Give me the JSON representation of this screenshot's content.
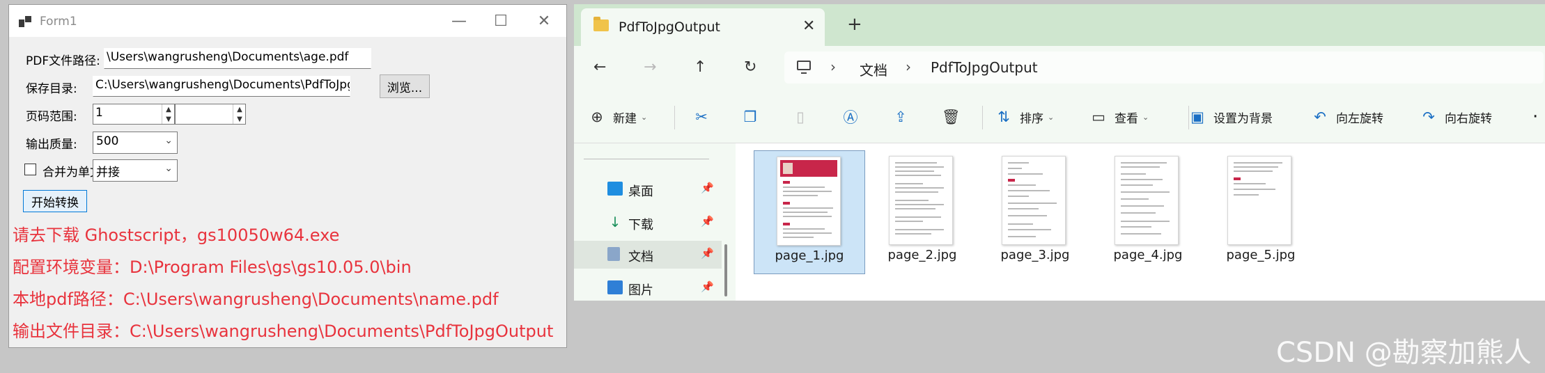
{
  "form1": {
    "title": "Form1",
    "window_controls": {
      "minimize": "—",
      "maximize": "☐",
      "close": "✕"
    },
    "pdf_path_label": "PDF文件路径:",
    "pdf_path_value": "\\Users\\wangrusheng\\Documents\\age.pdf",
    "save_dir_label": "保存目录:",
    "save_dir_value": "C:\\Users\\wangrusheng\\Documents\\PdfToJpgOutput",
    "browse_label": "浏览...",
    "page_range_label": "页码范围:",
    "page_from_value": "1",
    "page_to_value": "",
    "quality_label": "输出质量:",
    "quality_value": "500",
    "merge_label": "合并为单文件",
    "merge_mode_value": "并接",
    "start_label": "开始转换"
  },
  "notes": [
    "请去下载 Ghostscript，gs10050w64.exe",
    "配置环境变量：D:\\Program Files\\gs\\gs10.05.0\\bin",
    "本地pdf路径：C:\\Users\\wangrusheng\\Documents\\name.pdf",
    "输出文件目录：C:\\Users\\wangrusheng\\Documents\\PdfToJpgOutput"
  ],
  "explorer": {
    "tab_title": "PdfToJpgOutput",
    "tab_close": "✕",
    "new_tab": "+",
    "nav": {
      "back": "←",
      "forward": "→",
      "up": "↑",
      "refresh": "↻"
    },
    "breadcrumb": [
      "文档",
      "PdfToJpgOutput"
    ],
    "breadcrumb_sep": "›",
    "toolbar": {
      "new_label": "新建",
      "sort_label": "排序",
      "view_label": "查看",
      "set_background_label": "设置为背景",
      "rotate_left_label": "向左旋转",
      "rotate_right_label": "向右旋转",
      "more": "·"
    },
    "sidebar": [
      {
        "label": "桌面",
        "icon": "desktop-icon"
      },
      {
        "label": "下载",
        "icon": "download-icon"
      },
      {
        "label": "文档",
        "icon": "documents-icon"
      },
      {
        "label": "图片",
        "icon": "pictures-icon"
      }
    ],
    "files": [
      "page_1.jpg",
      "page_2.jpg",
      "page_3.jpg",
      "page_4.jpg",
      "page_5.jpg"
    ]
  },
  "watermark": "CSDN @勘察加熊人"
}
